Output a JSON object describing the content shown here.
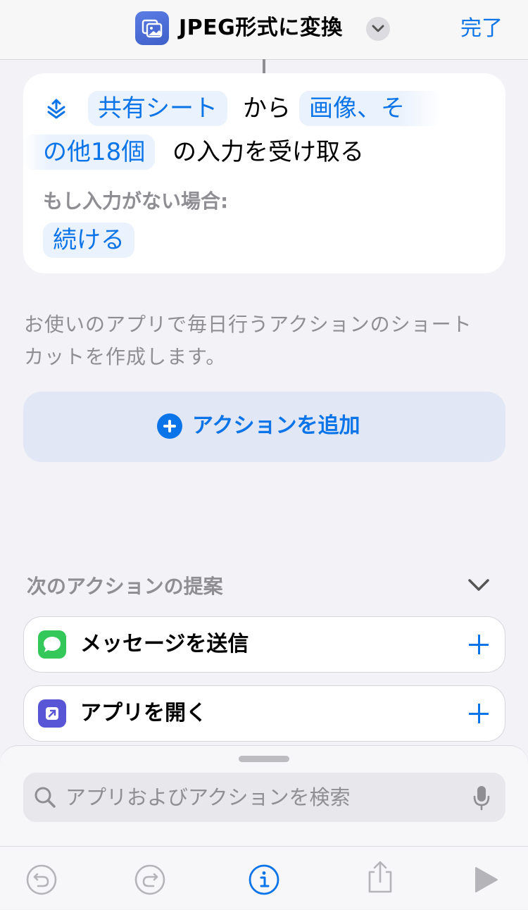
{
  "header": {
    "shortcut_name": "JPEG形式に変換",
    "done_label": "完了",
    "icon": "photos-shortcut-icon"
  },
  "action_card": {
    "icon": "share-sheet-icon",
    "token_source": "共有シート",
    "text_from": "から",
    "token_types_line1": "画像、そ",
    "token_types_line2": "の他18個",
    "text_receive": "の入力を受け取る",
    "if_no_input_label": "もし入力がない場合:",
    "token_continue": "続ける"
  },
  "description": "お使いのアプリで毎日行うアクションのショートカットを作成します。",
  "add_action_label": "アクションを追加",
  "suggestions": {
    "header": "次のアクションの提案",
    "items": [
      {
        "label": "メッセージを送信",
        "icon": "messages-app-icon",
        "color": "#34c759"
      },
      {
        "label": "アプリを開く",
        "icon": "open-app-icon",
        "color": "#5856d6"
      }
    ]
  },
  "search": {
    "placeholder": "アプリおよびアクションを検索"
  },
  "toolbar": {
    "items": [
      "undo-icon",
      "redo-icon",
      "info-icon",
      "share-icon",
      "play-icon"
    ]
  },
  "colors": {
    "accent": "#0a74e8",
    "background": "#f2f2f7"
  }
}
